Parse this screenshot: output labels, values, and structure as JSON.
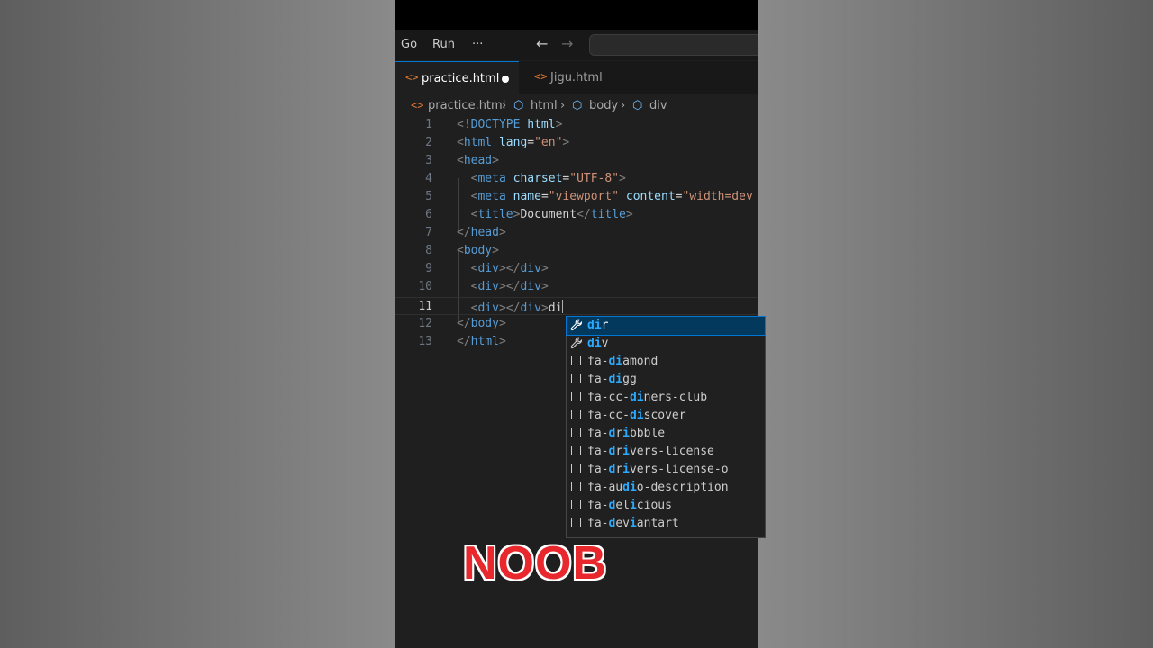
{
  "menubar": {
    "items": [
      "Go",
      "Run",
      "···"
    ],
    "back_icon": "arrow-left-icon",
    "forward_icon": "arrow-right-icon"
  },
  "tabs": [
    {
      "label": "practice.html",
      "icon": "html-file-icon",
      "active": true,
      "modified": true
    },
    {
      "label": "Jigu.html",
      "icon": "html-file-icon",
      "active": false,
      "modified": false
    }
  ],
  "breadcrumb": [
    "practice.html",
    "html",
    "body",
    "div"
  ],
  "editor": {
    "current_line": 11,
    "lines": [
      {
        "n": "1"
      },
      {
        "n": "2"
      },
      {
        "n": "3"
      },
      {
        "n": "4"
      },
      {
        "n": "5"
      },
      {
        "n": "6"
      },
      {
        "n": "7"
      },
      {
        "n": "8"
      },
      {
        "n": "9"
      },
      {
        "n": "10"
      },
      {
        "n": "11"
      },
      {
        "n": "12"
      },
      {
        "n": "13"
      }
    ],
    "code": {
      "doctype": "DOCTYPE",
      "html_tag": "html",
      "head_tag": "head",
      "meta_tag": "meta",
      "title_tag": "title",
      "body_tag": "body",
      "div_tag": "div",
      "lang_attr": "lang",
      "lang_val": "\"en\"",
      "charset_attr": "charset",
      "charset_val": "\"UTF-8\"",
      "name_attr": "name",
      "name_val": "\"viewport\"",
      "content_attr": "content",
      "content_val": "\"width=dev",
      "title_text": "Document",
      "typed_text": "di"
    }
  },
  "suggestions": [
    {
      "match": "di",
      "rest": "r",
      "prefix": "",
      "icon": "wrench-icon",
      "selected": true
    },
    {
      "match": "di",
      "rest": "v",
      "prefix": "",
      "icon": "wrench-icon",
      "selected": false
    },
    {
      "prefix": "fa-",
      "match": "di",
      "rest": "amond",
      "icon": "snippet-box-icon"
    },
    {
      "prefix": "fa-",
      "match": "di",
      "rest": "gg",
      "icon": "snippet-box-icon"
    },
    {
      "prefix": "fa-cc-",
      "match": "di",
      "rest": "ners-club",
      "icon": "snippet-box-icon"
    },
    {
      "prefix": "fa-",
      "match": "di",
      "rest": "scover",
      "prefix_full": "fa-cc-",
      "icon": "snippet-box-icon"
    },
    {
      "prefix": "fa-",
      "match": "d",
      "mid": "r",
      "match2": "i",
      "rest": "bbble",
      "icon": "snippet-box-icon"
    },
    {
      "prefix": "fa-",
      "match": "d",
      "mid": "r",
      "match2": "i",
      "rest": "vers-license",
      "icon": "snippet-box-icon"
    },
    {
      "prefix": "fa-",
      "match": "d",
      "mid": "r",
      "match2": "i",
      "rest": "vers-license-o",
      "icon": "snippet-box-icon"
    },
    {
      "prefix": "fa-au",
      "match": "di",
      "rest": "o-description",
      "icon": "snippet-box-icon"
    },
    {
      "prefix": "fa-",
      "match": "d",
      "mid": "el",
      "match2": "i",
      "rest": "cious",
      "icon": "snippet-box-icon"
    },
    {
      "prefix": "fa-",
      "match": "d",
      "mid": "ev",
      "match2": "i",
      "rest": "antart",
      "icon": "snippet-box-icon"
    }
  ],
  "overlay": {
    "caption": "NOOB"
  },
  "colors": {
    "accent": "#0078d4",
    "caption": "#e8282d",
    "highlight": "#2aaaff"
  }
}
